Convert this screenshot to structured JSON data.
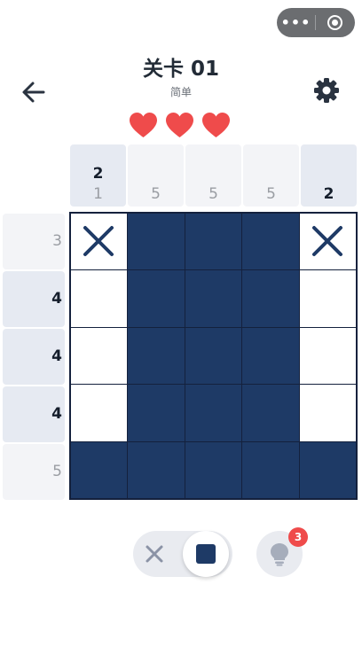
{
  "header": {
    "title": "关卡 01",
    "subtitle": "简单"
  },
  "lives": {
    "count": 3,
    "color": "#ef4b4b"
  },
  "column_clues": [
    {
      "top": "2",
      "bottom": "1",
      "highlight": true,
      "top_active": true,
      "bottom_active": false
    },
    {
      "top": "",
      "bottom": "5",
      "highlight": false,
      "top_active": false,
      "bottom_active": false
    },
    {
      "top": "",
      "bottom": "5",
      "highlight": false,
      "top_active": false,
      "bottom_active": false
    },
    {
      "top": "",
      "bottom": "5",
      "highlight": false,
      "top_active": false,
      "bottom_active": false
    },
    {
      "top": "",
      "bottom": "2",
      "highlight": true,
      "top_active": false,
      "bottom_active": true
    }
  ],
  "row_clues": [
    {
      "value": "3",
      "highlight": false,
      "active": false
    },
    {
      "value": "4",
      "highlight": true,
      "active": true
    },
    {
      "value": "4",
      "highlight": true,
      "active": true
    },
    {
      "value": "4",
      "highlight": true,
      "active": true
    },
    {
      "value": "5",
      "highlight": false,
      "active": false
    }
  ],
  "grid": [
    [
      "x",
      "f",
      "f",
      "f",
      "x"
    ],
    [
      "e",
      "f",
      "f",
      "f",
      "e"
    ],
    [
      "e",
      "f",
      "f",
      "f",
      "e"
    ],
    [
      "e",
      "f",
      "f",
      "f",
      "e"
    ],
    [
      "f",
      "f",
      "f",
      "f",
      "f"
    ]
  ],
  "controls": {
    "mode": "fill",
    "hint_count": "3"
  },
  "colors": {
    "fill": "#1e3a66",
    "border": "#14213d",
    "accent": "#ef4b4b"
  },
  "icons": {
    "back": "arrow-left-icon",
    "settings": "gear-icon",
    "hint": "lightbulb-icon",
    "mark": "x-icon"
  }
}
